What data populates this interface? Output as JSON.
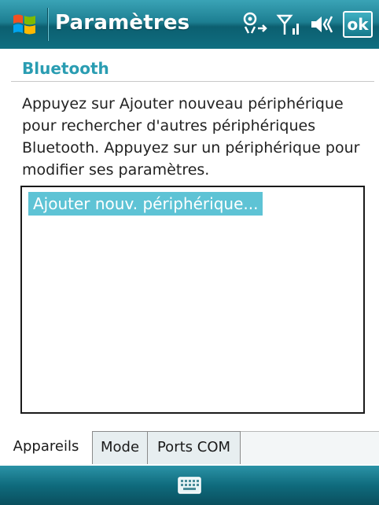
{
  "titlebar": {
    "title": "Paramètres",
    "ok_label": "ok",
    "icons": [
      "windows-logo-icon",
      "connectivity-icon",
      "signal-strength-icon",
      "volume-icon"
    ]
  },
  "page": {
    "heading": "Bluetooth",
    "instructions": "Appuyez sur Ajouter nouveau périphérique pour rechercher d'autres périphériques Bluetooth. Appuyez sur un périphérique pour modifier ses paramètres."
  },
  "device_list": {
    "items": [
      "Ajouter nouv. périphérique..."
    ],
    "selected_index": 0
  },
  "tabs": [
    {
      "label": "Appareils",
      "active": true
    },
    {
      "label": "Mode",
      "active": false
    },
    {
      "label": "Ports COM",
      "active": false
    }
  ],
  "bottombar": {
    "icon": "keyboard-icon"
  },
  "colors": {
    "titlebar": "#1d7f92",
    "accent_heading": "#2a9db2",
    "selection": "#5ec3d5"
  }
}
